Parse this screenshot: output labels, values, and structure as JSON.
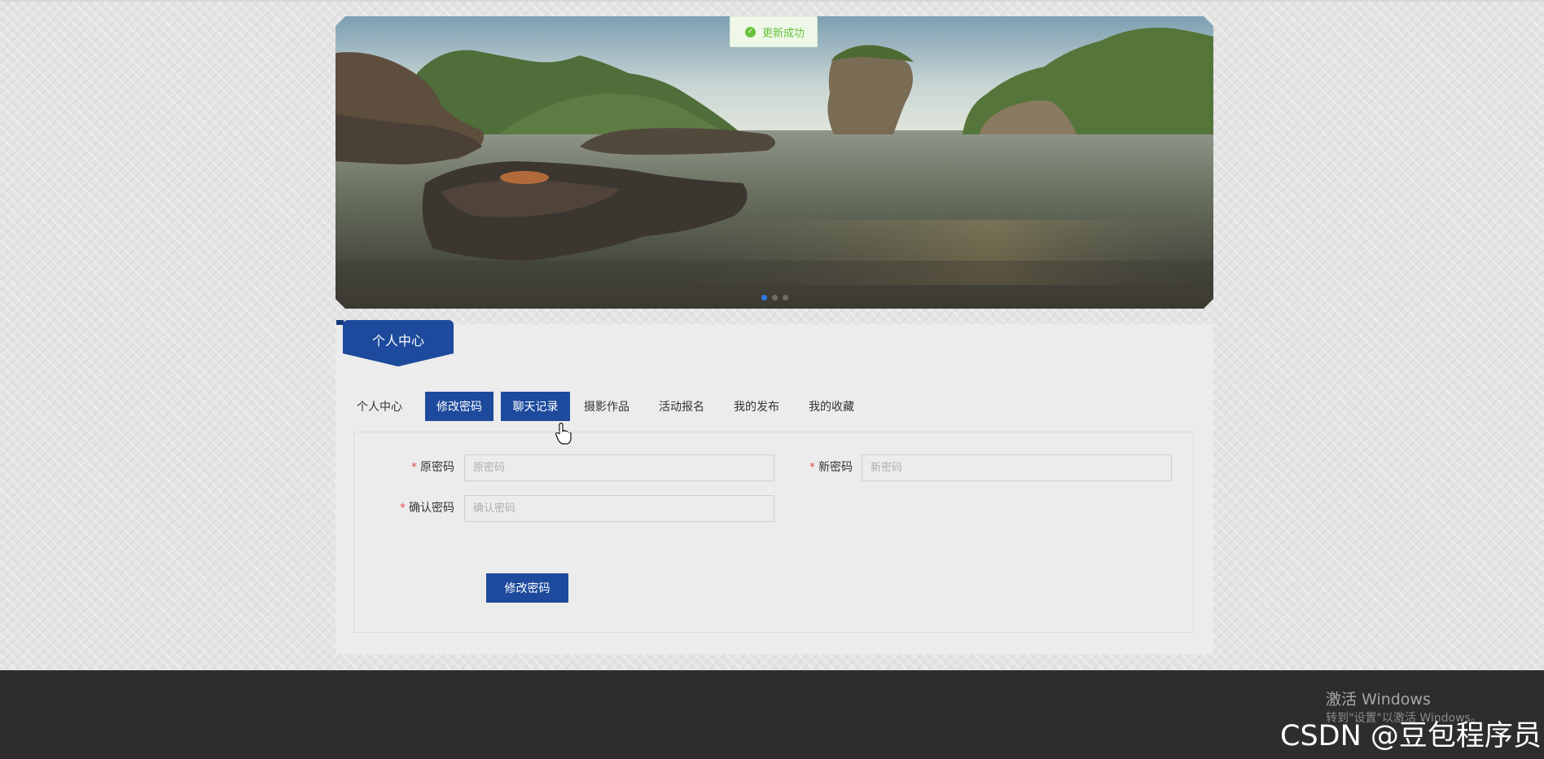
{
  "toast": {
    "message": "更新成功",
    "icon": "check-circle-icon",
    "color": "#67c23a"
  },
  "banner": {
    "slides": 3,
    "active_slide": 1
  },
  "panel": {
    "title": "个人中心"
  },
  "tabs": [
    {
      "label": "个人中心",
      "active": false
    },
    {
      "label": "修改密码",
      "active": true
    },
    {
      "label": "聊天记录",
      "active": true
    },
    {
      "label": "摄影作品",
      "active": false
    },
    {
      "label": "活动报名",
      "active": false
    },
    {
      "label": "我的发布",
      "active": false
    },
    {
      "label": "我的收藏",
      "active": false
    }
  ],
  "form": {
    "required_mark": "*",
    "old_password": {
      "label": "原密码",
      "placeholder": "原密码",
      "value": ""
    },
    "new_password": {
      "label": "新密码",
      "placeholder": "新密码",
      "value": ""
    },
    "confirm_password": {
      "label": "确认密码",
      "placeholder": "确认密码",
      "value": ""
    },
    "submit_label": "修改密码"
  },
  "watermark": {
    "activate_title": "激活 Windows",
    "activate_sub": "转到\"设置\"以激活 Windows。",
    "csdn": "CSDN @豆包程序员"
  },
  "colors": {
    "primary": "#1d4a9c",
    "footer": "#2d2d2d",
    "required": "#e34d4d"
  }
}
